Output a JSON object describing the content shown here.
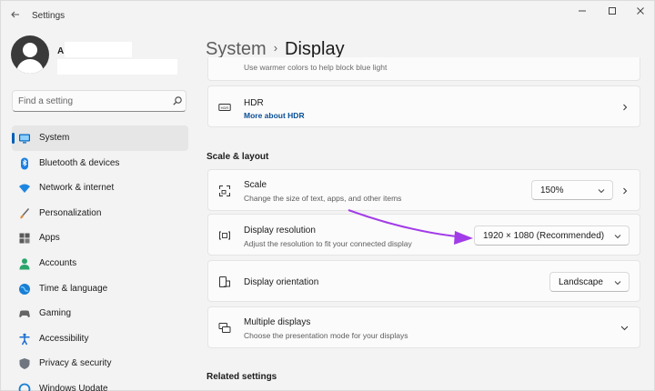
{
  "window": {
    "title": "Settings",
    "back_icon": "back-arrow-icon",
    "controls": [
      "minimize-icon",
      "maximize-icon",
      "close-icon"
    ]
  },
  "user": {
    "initial": "A",
    "avatar_icon": "user-avatar-icon"
  },
  "search": {
    "placeholder": "Find a setting",
    "value": "",
    "icon": "search-icon"
  },
  "sidebar": {
    "items": [
      {
        "label": "System",
        "icon": "monitor-icon",
        "active": true
      },
      {
        "label": "Bluetooth & devices",
        "icon": "bluetooth-icon"
      },
      {
        "label": "Network & internet",
        "icon": "wifi-icon"
      },
      {
        "label": "Personalization",
        "icon": "brush-icon"
      },
      {
        "label": "Apps",
        "icon": "apps-icon"
      },
      {
        "label": "Accounts",
        "icon": "person-icon"
      },
      {
        "label": "Time & language",
        "icon": "globe-clock-icon"
      },
      {
        "label": "Gaming",
        "icon": "gamepad-icon"
      },
      {
        "label": "Accessibility",
        "icon": "accessibility-icon"
      },
      {
        "label": "Privacy & security",
        "icon": "shield-icon"
      },
      {
        "label": "Windows Update",
        "icon": "update-icon"
      }
    ]
  },
  "header": {
    "parent": "System",
    "separator": "›",
    "current": "Display"
  },
  "main": {
    "cut_off_text": "Use warmer colors to help block blue light",
    "hdr": {
      "title": "HDR",
      "link": "More about HDR",
      "icon": "hdr-icon"
    },
    "scale_layout_heading": "Scale & layout",
    "scale": {
      "title": "Scale",
      "subtitle": "Change the size of text, apps, and other items",
      "value": "150%",
      "icon": "scale-icon"
    },
    "resolution": {
      "title": "Display resolution",
      "subtitle": "Adjust the resolution to fit your connected display",
      "value": "1920 × 1080 (Recommended)",
      "icon": "resolution-icon"
    },
    "orientation": {
      "title": "Display orientation",
      "value": "Landscape",
      "icon": "orientation-icon"
    },
    "multiple": {
      "title": "Multiple displays",
      "subtitle": "Choose the presentation mode for your displays",
      "icon": "multiple-displays-icon"
    },
    "related_heading": "Related settings"
  },
  "colors": {
    "accent": "#005fb8",
    "annotation_arrow": "#a23ce8",
    "link": "#0a4f96"
  }
}
